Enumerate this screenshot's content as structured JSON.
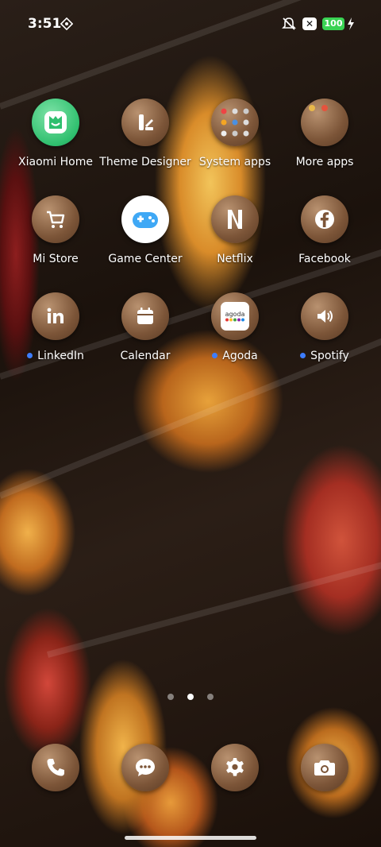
{
  "status_bar": {
    "time": "3:51",
    "battery_level": "100",
    "icons": [
      "diamond-icon",
      "mute-icon",
      "x-app-icon",
      "battery-icon",
      "charging-icon"
    ]
  },
  "apps": [
    {
      "label": "Xiaomi Home",
      "icon": "xiaomi-home-icon",
      "dot": false
    },
    {
      "label": "Theme Designer",
      "icon": "theme-designer-icon",
      "dot": false
    },
    {
      "label": "System apps",
      "icon": "folder-icon",
      "dot": false
    },
    {
      "label": "More apps",
      "icon": "folder-icon",
      "dot": false
    },
    {
      "label": "Mi Store",
      "icon": "cart-icon",
      "dot": false
    },
    {
      "label": "Game Center",
      "icon": "gamepad-icon",
      "dot": false
    },
    {
      "label": "Netflix",
      "icon": "netflix-icon",
      "dot": false
    },
    {
      "label": "Facebook",
      "icon": "facebook-icon",
      "dot": false
    },
    {
      "label": "LinkedIn",
      "icon": "linkedin-icon",
      "dot": true
    },
    {
      "label": "Calendar",
      "icon": "calendar-icon",
      "dot": false
    },
    {
      "label": "Agoda",
      "icon": "agoda-icon",
      "dot": true
    },
    {
      "label": "Spotify",
      "icon": "speaker-icon",
      "dot": true
    }
  ],
  "agoda_logo_text": "agoda",
  "pager": {
    "pages": 3,
    "active": 2
  },
  "dock": [
    {
      "name": "phone",
      "icon": "phone-icon"
    },
    {
      "name": "messages",
      "icon": "message-icon"
    },
    {
      "name": "settings",
      "icon": "gear-icon"
    },
    {
      "name": "camera",
      "icon": "camera-icon"
    }
  ],
  "colors": {
    "accent_dot": "#3d7dff",
    "battery": "#39d353",
    "icon_bronze": "#7c5538"
  }
}
